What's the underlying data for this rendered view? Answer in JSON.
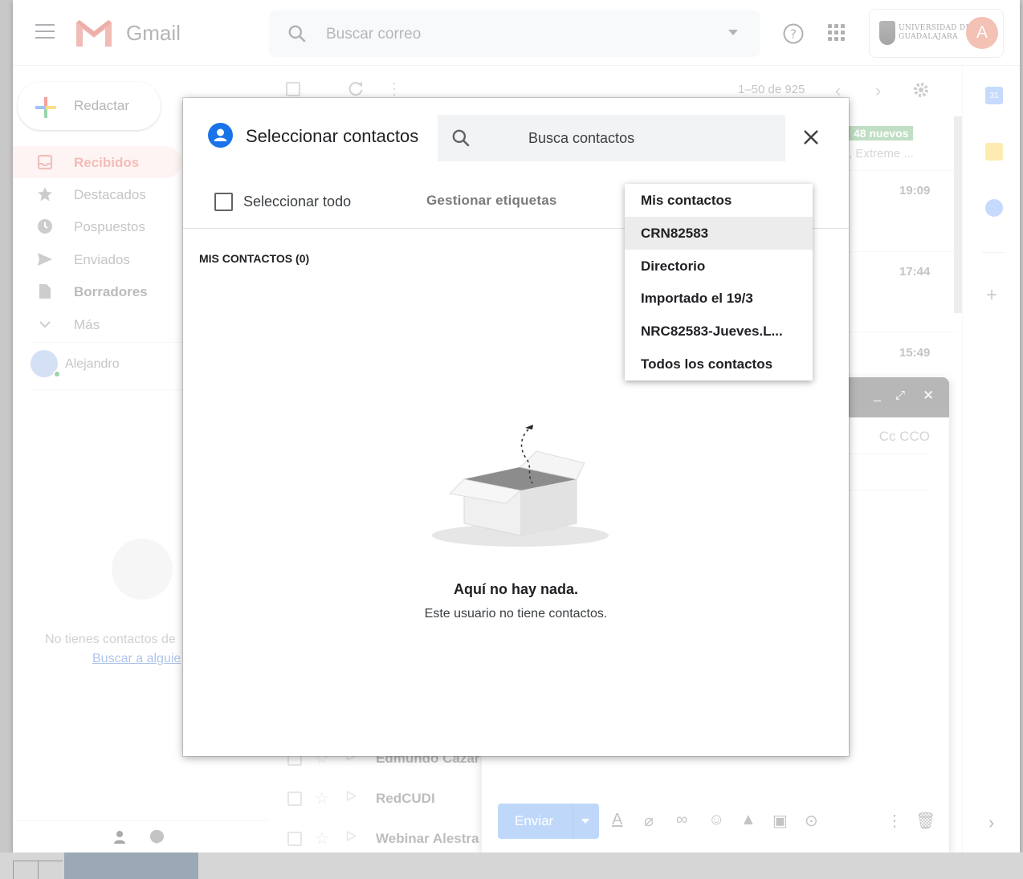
{
  "app": {
    "name": "Gmail"
  },
  "search": {
    "placeholder": "Buscar correo"
  },
  "org": {
    "line1": "UNIVERSIDAD DE",
    "line2": "GUADALAJARA"
  },
  "account": {
    "initial": "A"
  },
  "sidebar": {
    "compose_label": "Redactar",
    "items": [
      {
        "label": "Recibidos"
      },
      {
        "label": "Destacados"
      },
      {
        "label": "Pospuestos"
      },
      {
        "label": "Enviados"
      },
      {
        "label": "Borradores"
      },
      {
        "label": "Más"
      }
    ],
    "user": "Alejandro",
    "no_contacts": "No tienes contactos de",
    "find_link": "Buscar a alguie"
  },
  "list": {
    "pager": "1–50 de 925",
    "new_badge": "48 nuevos",
    "snippet": ", Extreme ...",
    "times": [
      "19:09",
      "17:44",
      "15:49"
    ],
    "rows": [
      {
        "from": "Edmundo Cazar"
      },
      {
        "from": "RedCUDI"
      },
      {
        "from": "Webinar Alestra"
      }
    ]
  },
  "compose": {
    "cc_bcc": "Cc CCO",
    "send_label": "Enviar"
  },
  "dialog": {
    "title": "Seleccionar contactos",
    "search_placeholder": "Busca contactos",
    "select_all": "Seleccionar todo",
    "manage_labels": "Gestionar etiquetas",
    "section": "MIS CONTACTOS (0)",
    "empty_title": "Aquí no hay nada.",
    "empty_sub": "Este usuario no tiene contactos."
  },
  "menu": {
    "items": [
      {
        "label": "Mis contactos"
      },
      {
        "label": "CRN82583"
      },
      {
        "label": "Directorio"
      },
      {
        "label": "Importado el 19/3"
      },
      {
        "label": "NRC82583-Jueves.L..."
      },
      {
        "label": "Todos los contactos"
      }
    ],
    "highlighted_index": 1
  },
  "colors": {
    "accent": "#1a73e8",
    "gmail_red": "#d93025",
    "send_button": "#7fb0f5",
    "avatar": "#e8836b"
  }
}
